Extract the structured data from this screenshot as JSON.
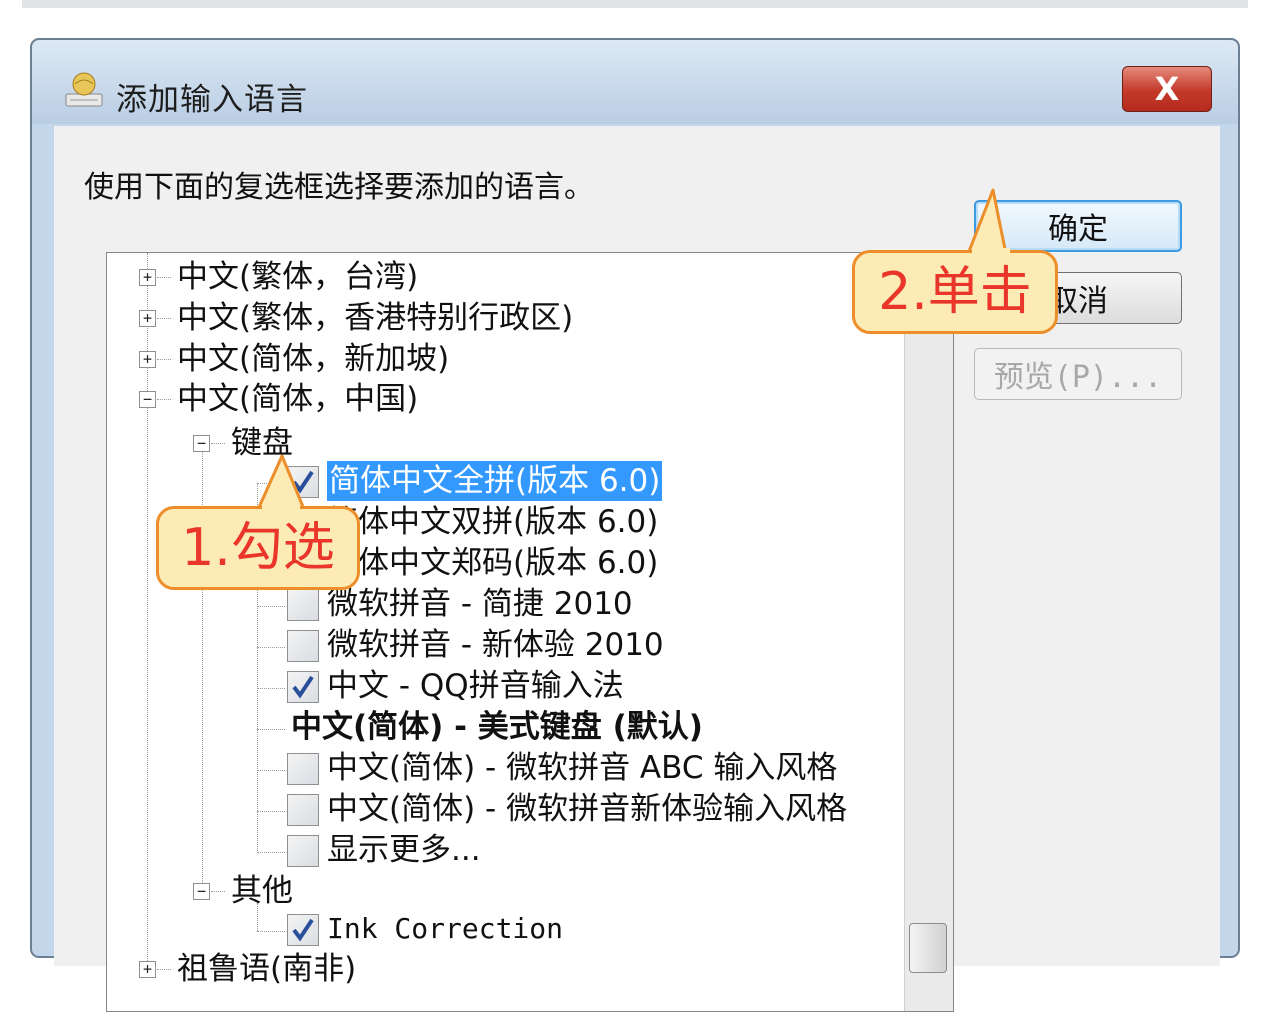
{
  "window": {
    "title": "添加输入语言",
    "close_label": "X"
  },
  "instruction": "使用下面的复选框选择要添加的语言。",
  "buttons": {
    "ok": "确定",
    "cancel": "取消",
    "preview": "预览(P)..."
  },
  "tree": {
    "items": [
      {
        "label": "中文(繁体，台湾)",
        "expander": "+"
      },
      {
        "label": "中文(繁体，香港特别行政区)",
        "expander": "+"
      },
      {
        "label": "中文(简体，新加坡)",
        "expander": "+"
      },
      {
        "label": "中文(简体，中国)",
        "expander": "−"
      },
      {
        "label": "键盘",
        "expander": "−"
      },
      {
        "label": "简体中文全拼(版本 6.0)",
        "checked": true,
        "selected": true
      },
      {
        "label": "简体中文双拼(版本 6.0)",
        "checked": false
      },
      {
        "label": "简体中文郑码(版本 6.0)",
        "checked": false
      },
      {
        "label": "微软拼音 - 简捷 2010",
        "checked": false
      },
      {
        "label": "微软拼音 - 新体验 2010",
        "checked": false
      },
      {
        "label": "中文 - QQ拼音输入法",
        "checked": true
      },
      {
        "label": "中文(简体) - 美式键盘 (默认)"
      },
      {
        "label": "中文(简体) - 微软拼音 ABC 输入风格",
        "checked": false
      },
      {
        "label": "中文(简体) - 微软拼音新体验输入风格",
        "checked": false
      },
      {
        "label": "显示更多...",
        "checked": false
      },
      {
        "label": "其他",
        "expander": "−"
      },
      {
        "label": "Ink Correction",
        "checked": true
      },
      {
        "label": "祖鲁语(南非)",
        "expander": "+"
      }
    ]
  },
  "callouts": {
    "step1": "1.勾选",
    "step2": "2.单击"
  },
  "colors": {
    "selection": "#3399ff",
    "callout_fill": "#fdebb6",
    "callout_border": "#ec8e2a",
    "callout_text": "#e9352a",
    "close_button": "#c4392a"
  }
}
